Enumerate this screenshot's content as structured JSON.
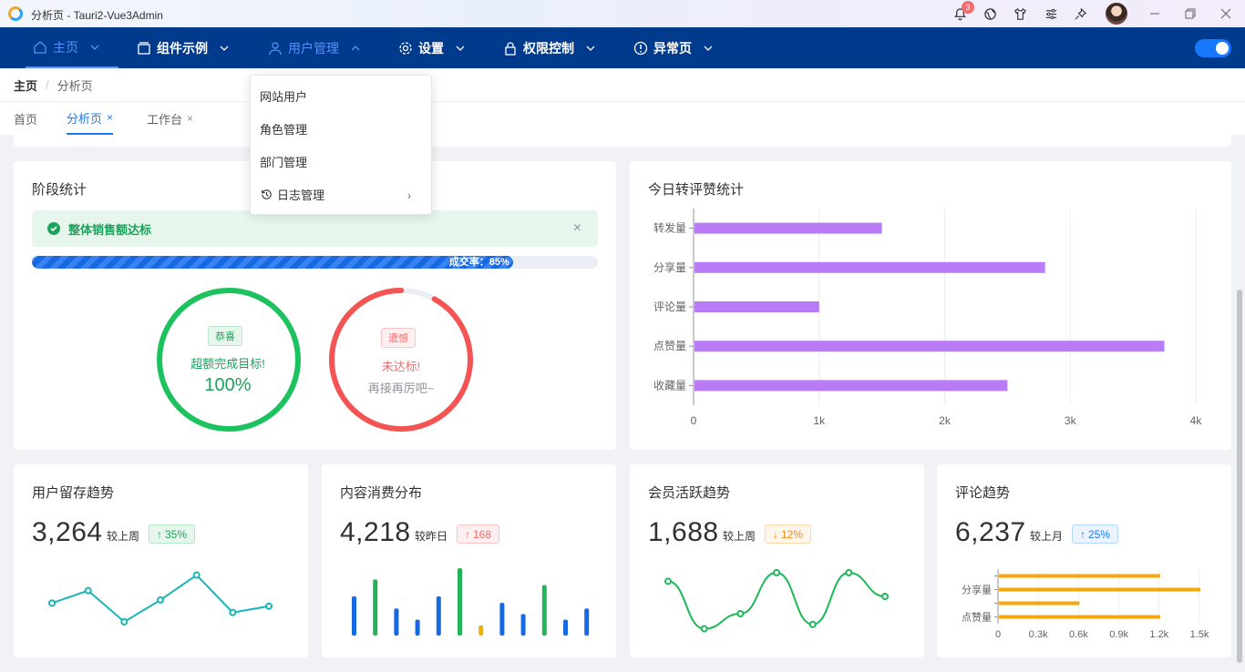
{
  "window": {
    "title": "分析页 - Tauri2-Vue3Admin",
    "notification_count": "3"
  },
  "nav": {
    "items": [
      {
        "label": "主页",
        "icon": "home-icon"
      },
      {
        "label": "组件示例",
        "icon": "components-icon"
      },
      {
        "label": "用户管理",
        "icon": "user-icon"
      },
      {
        "label": "设置",
        "icon": "gear-icon"
      },
      {
        "label": "权限控制",
        "icon": "lock-icon"
      },
      {
        "label": "异常页",
        "icon": "warning-icon"
      }
    ]
  },
  "breadcrumb": {
    "home": "主页",
    "separator": "/",
    "current": "分析页"
  },
  "tabs": [
    {
      "label": "首页"
    },
    {
      "label": "分析页",
      "close": "×"
    },
    {
      "label": "工作台",
      "close": "×"
    }
  ],
  "dropdown": {
    "items": [
      "网站用户",
      "角色管理",
      "部门管理",
      "日志管理"
    ]
  },
  "stage": {
    "title": "阶段统计",
    "alert": "整体销售额达标",
    "alert_close": "×",
    "progress_text": "成交率：85%",
    "progress_value": 85,
    "success": {
      "tag": "恭喜",
      "main": "超额完成目标!",
      "value": "100%"
    },
    "fail": {
      "tag": "遗憾",
      "main": "未达标!",
      "sub": "再接再厉吧~",
      "arc_fraction": 0.92
    }
  },
  "today": {
    "title": "今日转评赞统计",
    "chart_data": {
      "type": "bar",
      "orientation": "horizontal",
      "categories": [
        "转发量",
        "分享量",
        "评论量",
        "点赞量",
        "收藏量"
      ],
      "values": [
        1500,
        2800,
        1000,
        3750,
        2500
      ],
      "xlim": [
        0,
        4000
      ],
      "x_ticks": [
        "0",
        "1k",
        "2k",
        "3k",
        "4k"
      ],
      "grid": true,
      "color": "#b97cf6"
    }
  },
  "cards": [
    {
      "title": "用户留存趋势",
      "value": "3,264",
      "compare": "较上周",
      "change": "35%",
      "direction": "up",
      "color": "#1ca35b",
      "bg": "#e7f6ed",
      "border": "#b7e8c9",
      "chart_data": {
        "type": "line",
        "x": [
          1,
          2,
          3,
          4,
          5,
          6,
          7
        ],
        "values": [
          52,
          60,
          40,
          54,
          70,
          46,
          50
        ],
        "color": "#17b6b5"
      }
    },
    {
      "title": "内容消费分布",
      "value": "4,218",
      "compare": "较昨日",
      "change": "168",
      "direction": "up",
      "color": "#f56c6c",
      "bg": "#fef0f0",
      "border": "#fbc4c4",
      "chart_data": {
        "type": "bar",
        "x": [
          1,
          2,
          3,
          4,
          5,
          6,
          7,
          8,
          9,
          10,
          11,
          12,
          13,
          14
        ],
        "values": [
          42,
          60,
          29,
          17,
          42,
          72,
          11,
          35,
          23,
          54,
          17,
          29,
          0,
          0
        ],
        "colors": [
          "#1668e3",
          "#24b25a",
          "#1668e3",
          "#1668e3",
          "#1668e3",
          "#24b25a",
          "#f5b000",
          "#1668e3",
          "#1668e3",
          "#24b25a",
          "#1668e3",
          "#1668e3"
        ]
      }
    },
    {
      "title": "会员活跃趋势",
      "value": "1,688",
      "compare": "较上周",
      "change": "12%",
      "direction": "down",
      "color": "#f08b1e",
      "bg": "#fdf6ec",
      "border": "#f8d9a8",
      "chart_data": {
        "type": "line",
        "smooth": true,
        "x": [
          1,
          2,
          3,
          4,
          5,
          6,
          7
        ],
        "values": [
          62,
          18,
          32,
          70,
          22,
          70,
          48
        ],
        "color": "#1cb957"
      }
    },
    {
      "title": "评论趋势",
      "value": "6,237",
      "compare": "较上月",
      "change": "25%",
      "direction": "up",
      "color": "#1677ff",
      "bg": "#ecf5ff",
      "border": "#b3d8ff",
      "chart_data": {
        "type": "bar",
        "orientation": "horizontal",
        "categories": [
          "点赞量",
          "",
          "分享量",
          ""
        ],
        "values": [
          1200,
          600,
          1500,
          1200
        ],
        "xlim": [
          0,
          1500
        ],
        "x_ticks": [
          "0",
          "0.3k",
          "0.6k",
          "0.9k",
          "1.2k",
          "1.5k"
        ],
        "color": "#f5a60a"
      }
    }
  ]
}
